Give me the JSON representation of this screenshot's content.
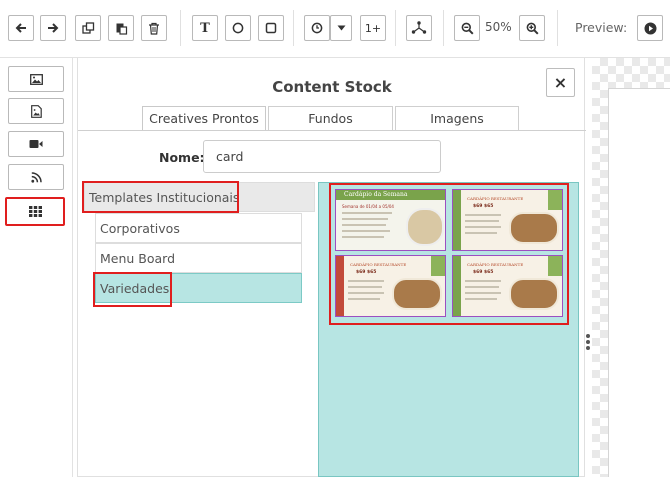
{
  "toolbar": {
    "zoom_level": "50%",
    "page_indicator": "1+",
    "preview_label": "Preview:",
    "text_tool_label": "T"
  },
  "rail": {
    "items": [
      "image-icon",
      "image-file-icon",
      "video-icon",
      "rss-icon",
      "grid-icon"
    ],
    "active": "grid-icon"
  },
  "panel": {
    "title": "Content Stock",
    "close_label": "×",
    "tabs": [
      "Creatives Prontos",
      "Fundos",
      "Imagens"
    ],
    "active_tab": "Creatives Prontos",
    "name_label": "Nome:",
    "name_value": "card",
    "categories": {
      "header": "Templates Institucionais",
      "items": [
        "Corporativos",
        "Menu Board",
        "Variedades"
      ],
      "selected": "Variedades"
    },
    "thumbnails": [
      {
        "title": "Cardápio da Semana",
        "subtitle": "Semana de 01/04 a 05/04"
      },
      {
        "title": "CARDÁPIO RESTAURANTE",
        "subtitle": "$69 $65"
      },
      {
        "title": "CARDÁPIO RESTAURANTE",
        "subtitle": "$69 $65"
      },
      {
        "title": "CARDÁPIO RESTAURANTE",
        "subtitle": "$69 $65"
      }
    ]
  },
  "colors": {
    "accent_selected": "#b7e5e3",
    "highlight_red": "#e01e1e",
    "thumb_border": "#9c4fc1"
  }
}
